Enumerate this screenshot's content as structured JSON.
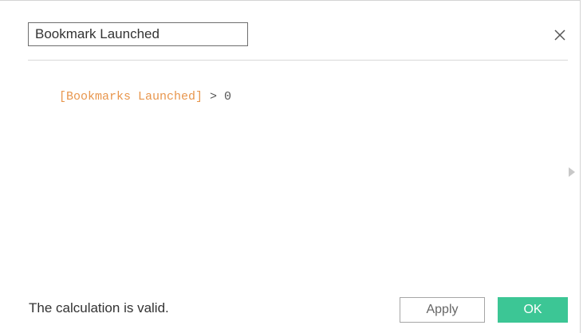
{
  "dialog": {
    "name_value": "Bookmark Launched",
    "close_icon": "close-icon",
    "expand_icon": "triangle-right-icon"
  },
  "formula": {
    "field": "[Bookmarks Launched]",
    "operator": " > 0"
  },
  "footer": {
    "status": "The calculation is valid.",
    "apply_label": "Apply",
    "ok_label": "OK"
  },
  "colors": {
    "field_reference": "#e8964d",
    "ok_button": "#3cc695"
  }
}
